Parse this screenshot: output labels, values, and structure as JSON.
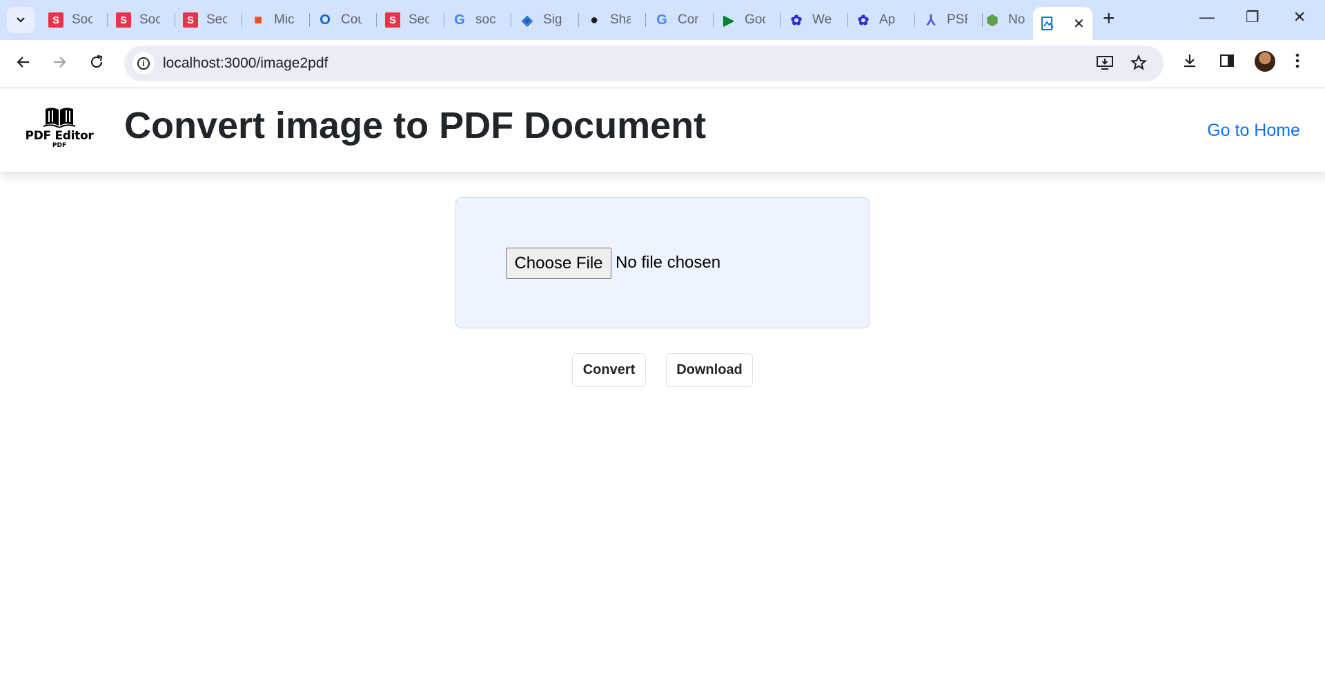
{
  "browser": {
    "tabs": [
      {
        "label": "Soc",
        "icon": "s-red-icon",
        "color": "#e8344a",
        "glyph": "S"
      },
      {
        "label": "Soc",
        "icon": "s-red-icon",
        "color": "#e8344a",
        "glyph": "S"
      },
      {
        "label": "Sec",
        "icon": "s-red-icon",
        "color": "#e8344a",
        "glyph": "S"
      },
      {
        "label": "Mic",
        "icon": "microsoft-icon",
        "color": "#f25022",
        "glyph": "■"
      },
      {
        "label": "Cou",
        "icon": "outlook-icon",
        "color": "#0a64c8",
        "glyph": "O"
      },
      {
        "label": "Sec",
        "icon": "s-red-icon",
        "color": "#e8344a",
        "glyph": "S"
      },
      {
        "label": "soc",
        "icon": "google-icon",
        "color": "#ffffff",
        "glyph": "G"
      },
      {
        "label": "Sig",
        "icon": "sign-icon",
        "color": "#1565c0",
        "glyph": "◈"
      },
      {
        "label": "Sha",
        "icon": "github-icon",
        "color": "#1f1f1f",
        "glyph": "●"
      },
      {
        "label": "Cor",
        "icon": "google-icon",
        "color": "#ffffff",
        "glyph": "G"
      },
      {
        "label": "Goo",
        "icon": "google-meet-icon",
        "color": "#00832d",
        "glyph": "▶"
      },
      {
        "label": "We",
        "icon": "chatgpt-icon",
        "color": "#2b2bd6",
        "glyph": "✿"
      },
      {
        "label": "Ap",
        "icon": "chatgpt-icon",
        "color": "#2b2bd6",
        "glyph": "✿"
      },
      {
        "label": "PSF",
        "icon": "pdf-tool-icon",
        "color": "#4a4adf",
        "glyph": "⅄"
      },
      {
        "label": "No",
        "icon": "nodejs-icon",
        "color": "#5fa04e",
        "glyph": "⬢"
      }
    ],
    "url": "localhost:3000/image2pdf"
  },
  "app": {
    "logo_text": "PDF Editor",
    "logo_sub": "PDF",
    "title": "Convert image to PDF Document",
    "home_link": "Go to Home"
  },
  "upload": {
    "button_label": "Choose File",
    "status": "No file chosen"
  },
  "actions": {
    "convert": "Convert",
    "download": "Download"
  },
  "colors": {
    "tabstrip": "#d3e3fd",
    "link": "#0d6efd",
    "card_bg": "#edf4fd"
  }
}
